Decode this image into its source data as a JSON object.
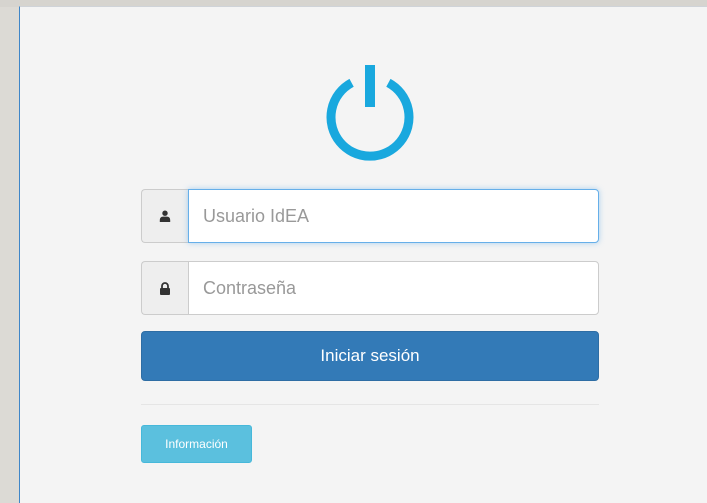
{
  "logo": {
    "icon": "power-icon",
    "color": "#19a8de"
  },
  "login_form": {
    "username": {
      "icon": "user-icon",
      "placeholder": "Usuario IdEA",
      "value": ""
    },
    "password": {
      "icon": "lock-icon",
      "placeholder": "Contraseña",
      "value": ""
    },
    "submit_label": "Iniciar sesión",
    "info_label": "Información"
  },
  "colors": {
    "primary_button": "#337ab7",
    "info_button": "#5bc0de",
    "focus_border": "#66afe9",
    "panel_background": "#f4f4f4"
  }
}
